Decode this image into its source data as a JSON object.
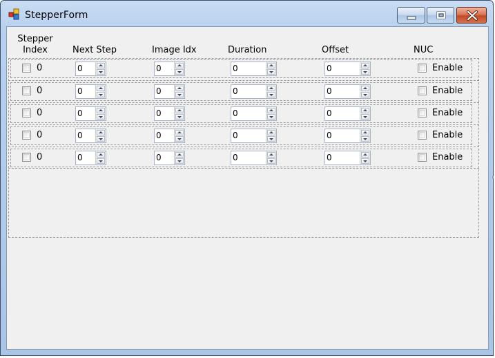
{
  "window": {
    "title": "StepperForm"
  },
  "columns": {
    "stepper_line1": "Stepper",
    "stepper_line2": "Index",
    "next_step": "Next Step",
    "image_idx": "Image Idx",
    "duration": "Duration",
    "offset": "Offset",
    "nuc": "NUC"
  },
  "rows": [
    {
      "index": "0",
      "next_step": "0",
      "image_idx": "0",
      "duration": "0",
      "offset": "0",
      "nuc_label": "Enable"
    },
    {
      "index": "0",
      "next_step": "0",
      "image_idx": "0",
      "duration": "0",
      "offset": "0",
      "nuc_label": "Enable"
    },
    {
      "index": "0",
      "next_step": "0",
      "image_idx": "0",
      "duration": "0",
      "offset": "0",
      "nuc_label": "Enable"
    },
    {
      "index": "0",
      "next_step": "0",
      "image_idx": "0",
      "duration": "0",
      "offset": "0",
      "nuc_label": "Enable"
    },
    {
      "index": "0",
      "next_step": "0",
      "image_idx": "0",
      "duration": "0",
      "offset": "0",
      "nuc_label": "Enable"
    }
  ],
  "icons": {
    "app": "app-icon",
    "minimize": "minimize-icon",
    "maximize": "maximize-icon",
    "close": "close-icon",
    "spin_up": "chevron-up-icon",
    "spin_down": "chevron-down-icon"
  },
  "colors": {
    "titlebar": "#b9d1ee",
    "client_bg": "#f0f0f0",
    "close_button": "#c14a28"
  }
}
